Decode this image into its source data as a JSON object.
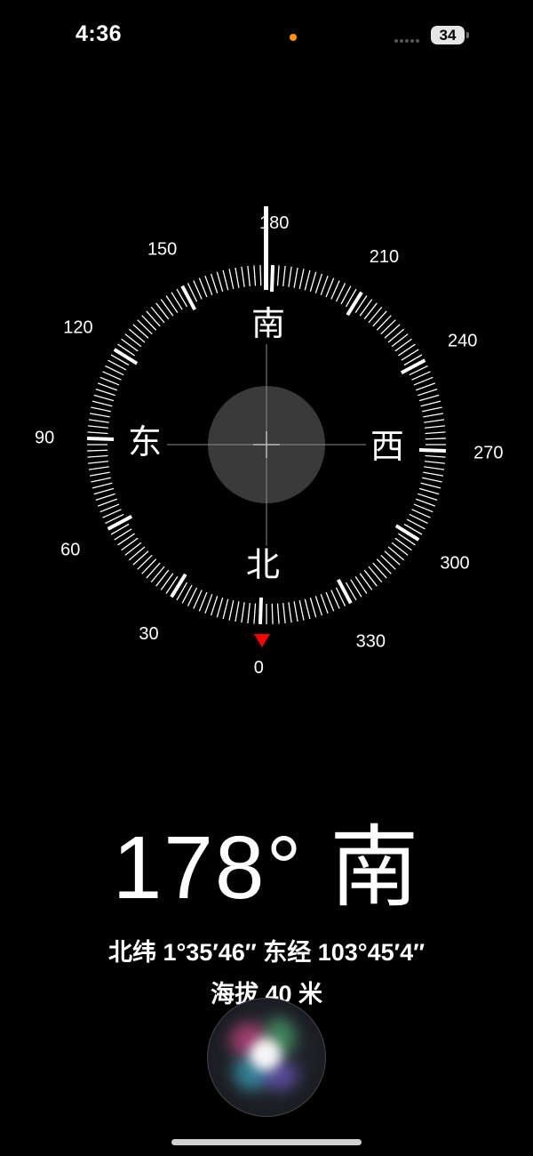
{
  "status_bar": {
    "time": "4:36",
    "battery_level": "34",
    "privacy_indicator_color": "#ff9500"
  },
  "compass": {
    "degree_labels": [
      "0",
      "30",
      "60",
      "90",
      "120",
      "150",
      "180",
      "210",
      "240",
      "270",
      "300",
      "330"
    ],
    "cardinals": {
      "north": "北",
      "east": "东",
      "south": "南",
      "west": "西"
    },
    "marker_color": "#ff0000",
    "heading_degrees": 178
  },
  "readout": {
    "heading": "178° 南",
    "coordinates": "北纬 1°35′46″  东经 103°45′4″",
    "altitude": "海拔 40 米"
  },
  "icons": {
    "siri": "siri-orb-icon",
    "home": "home-indicator"
  }
}
